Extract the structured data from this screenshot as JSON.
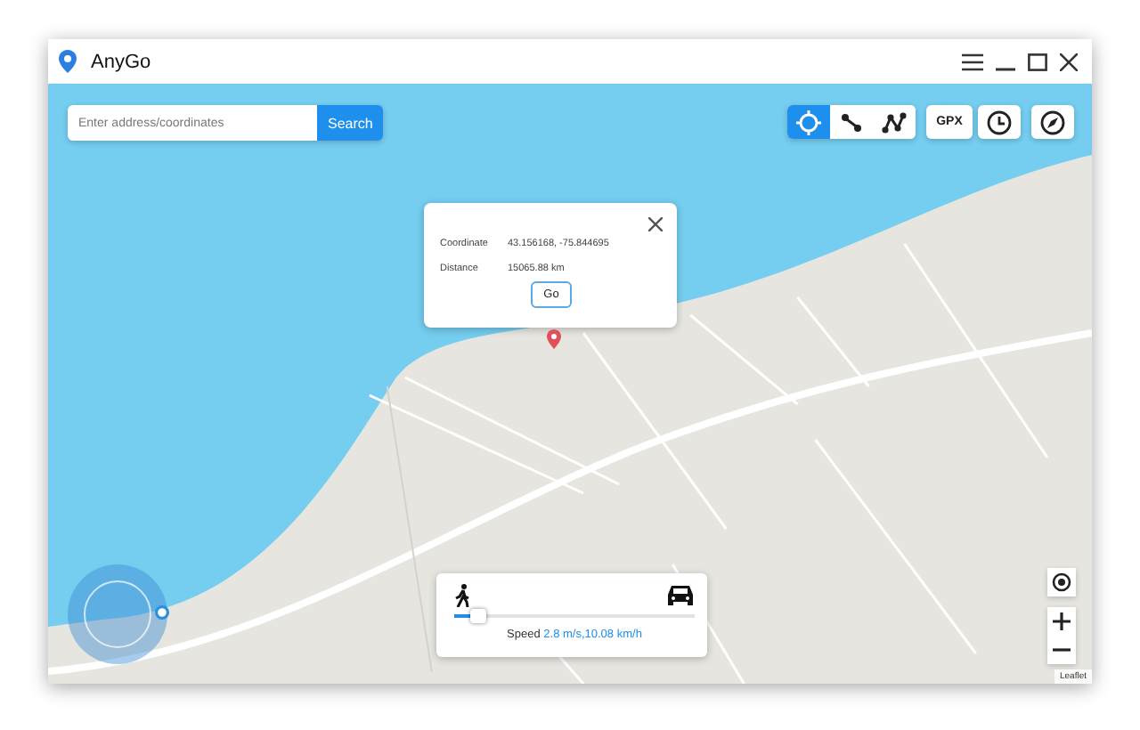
{
  "window": {
    "title": "AnyGo"
  },
  "search": {
    "placeholder": "Enter address/coordinates",
    "button": "Search"
  },
  "modes": [
    {
      "kind": "teleport",
      "selected": true
    },
    {
      "kind": "two-spot",
      "selected": false
    },
    {
      "kind": "multi-spot",
      "selected": false
    }
  ],
  "tools": [
    {
      "kind": "text",
      "label": "GPX"
    },
    {
      "kind": "history"
    },
    {
      "kind": "compass"
    }
  ],
  "popup": {
    "rows": [
      {
        "label": "Coordinate",
        "value": "43.156168, -75.844695"
      },
      {
        "label": "Distance",
        "value": "15065.88 km"
      }
    ],
    "button": "Go"
  },
  "speed": {
    "level": 0.1,
    "label": "Speed",
    "value": "2.8 m/s,10.08 km/h"
  },
  "map": {
    "attribution": "Leaflet"
  }
}
